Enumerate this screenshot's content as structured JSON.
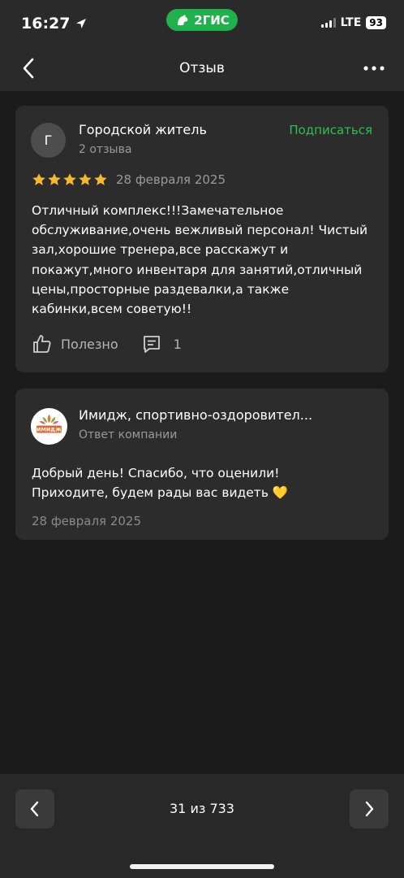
{
  "status_bar": {
    "time": "16:27",
    "brand": "2ГИС",
    "network": "LTE",
    "battery": "93"
  },
  "nav": {
    "title": "Отзыв"
  },
  "review": {
    "avatar_letter": "Г",
    "author": "Городской житель",
    "author_reviews": "2 отзыва",
    "subscribe_label": "Подписаться",
    "rating": 5,
    "date": "28 февраля 2025",
    "text": "Отличный комплекс!!!Замечательное обслуживание,очень вежливый персонал! Чистый зал,хорошие тренера,все расскажут и покажут,много инвентаря для занятий,отличный цены,просторные раздевалки,а также кабинки,всем советую!!",
    "useful_label": "Полезно",
    "comments_count": "1"
  },
  "reply": {
    "company": "Имидж, спортивно-оздоровител...",
    "role": "Ответ компании",
    "text": "Добрый день! Спасибо, что оценили!\nПриходите, будем рады вас видеть 💛",
    "date": "28 февраля 2025",
    "logo_text": "ИМИДЖ"
  },
  "pagination": {
    "counter": "31 из 733"
  },
  "colors": {
    "accent_green": "#2fbf54",
    "star": "#f5b82e",
    "card_bg": "#2c2c2c"
  }
}
